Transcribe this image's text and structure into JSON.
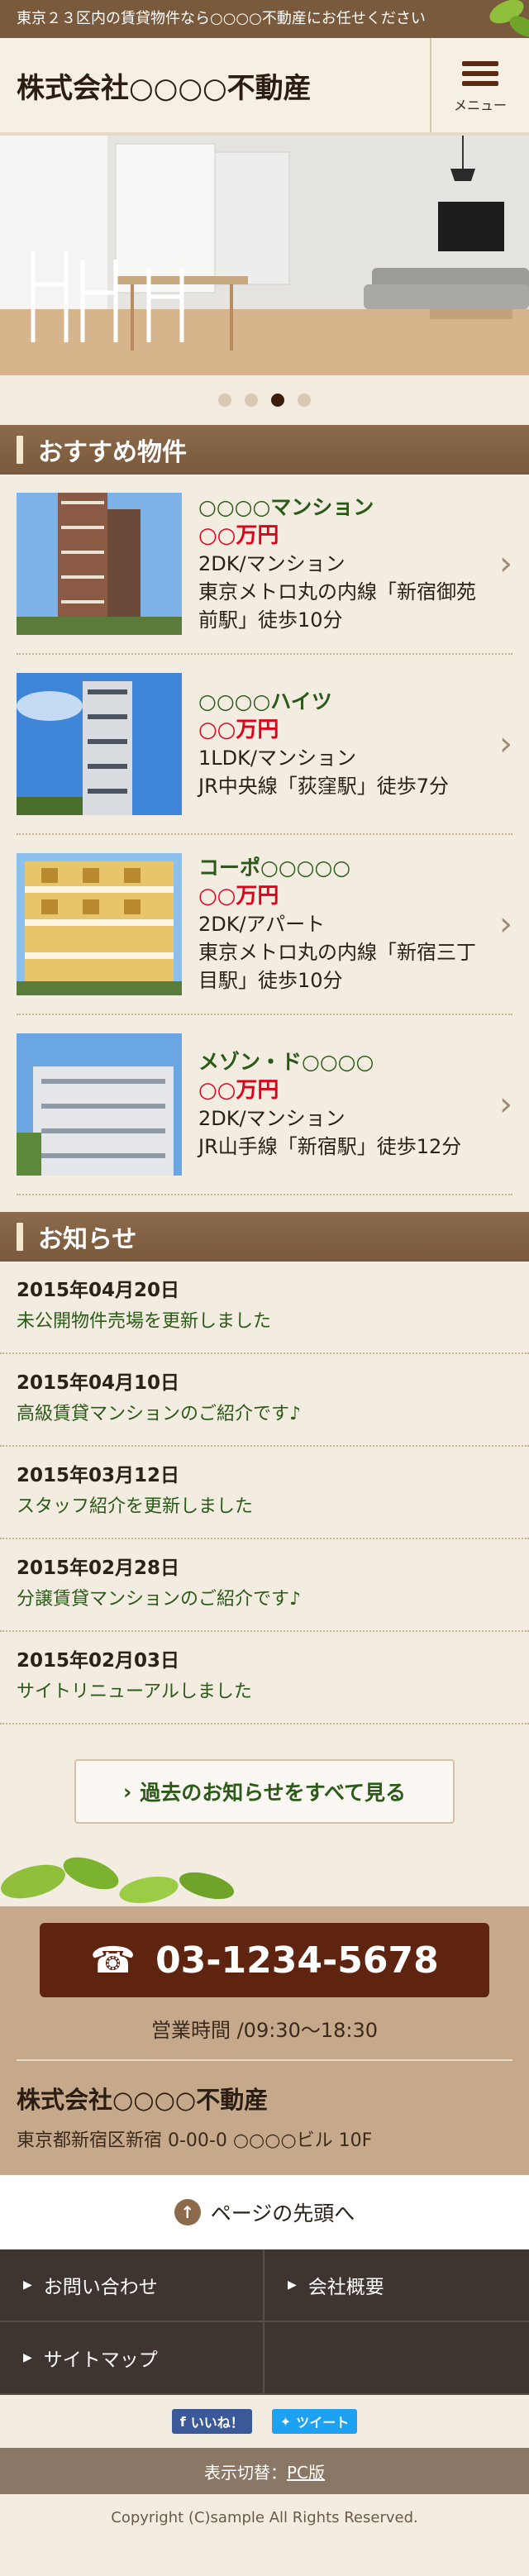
{
  "topbar": {
    "text": "東京２３区内の賃貸物件なら○○○○不動産にお任せください"
  },
  "header": {
    "logo": "株式会社○○○○不動産",
    "menu_label": "メニュー"
  },
  "slider": {
    "dots": 4,
    "active_index": 2
  },
  "recommended": {
    "heading": "おすすめ物件",
    "items": [
      {
        "name": "○○○○マンション",
        "price": "○○万円",
        "type": "2DK/マンション",
        "access": "東京メトロ丸の内線「新宿御苑前駅」徒歩10分"
      },
      {
        "name": "○○○○ハイツ",
        "price": "○○万円",
        "type": "1LDK/マンション",
        "access": "JR中央線「荻窪駅」徒歩7分"
      },
      {
        "name": "コーポ○○○○○",
        "price": "○○万円",
        "type": "2DK/アパート",
        "access": "東京メトロ丸の内線「新宿三丁目駅」徒歩10分"
      },
      {
        "name": "メゾン・ド○○○○",
        "price": "○○万円",
        "type": "2DK/マンション",
        "access": "JR山手線「新宿駅」徒歩12分"
      }
    ]
  },
  "news": {
    "heading": "お知らせ",
    "items": [
      {
        "date": "2015年04月20日",
        "title": "未公開物件売場を更新しました"
      },
      {
        "date": "2015年04月10日",
        "title": "高級賃貸マンションのご紹介です♪"
      },
      {
        "date": "2015年03月12日",
        "title": "スタッフ紹介を更新しました"
      },
      {
        "date": "2015年02月28日",
        "title": "分譲賃貸マンションのご紹介です♪"
      },
      {
        "date": "2015年02月03日",
        "title": "サイトリニューアルしました"
      }
    ],
    "more_label": "過去のお知らせをすべて見る"
  },
  "contact": {
    "phone": "03-1234-5678",
    "hours": "営業時間 /09:30～18:30",
    "company": "株式会社○○○○不動産",
    "address": "東京都新宿区新宿 0-00-0 ○○○○ビル 10F"
  },
  "pagetop": {
    "label": "ページの先頭へ"
  },
  "footer_nav": {
    "contact": "お問い合わせ",
    "about": "会社概要",
    "sitemap": "サイトマップ"
  },
  "social": {
    "like": "いいね！",
    "tweet": "ツイート"
  },
  "switcher": {
    "label": "表示切替：",
    "pc": "PC版"
  },
  "copyright": "Copyright (C)sample All Rights Reserved.",
  "colors": {
    "brown_dark": "#5e2410",
    "green_text": "#2b5a18",
    "price_red": "#e0001a",
    "header_bar": "#7a5a3c"
  }
}
